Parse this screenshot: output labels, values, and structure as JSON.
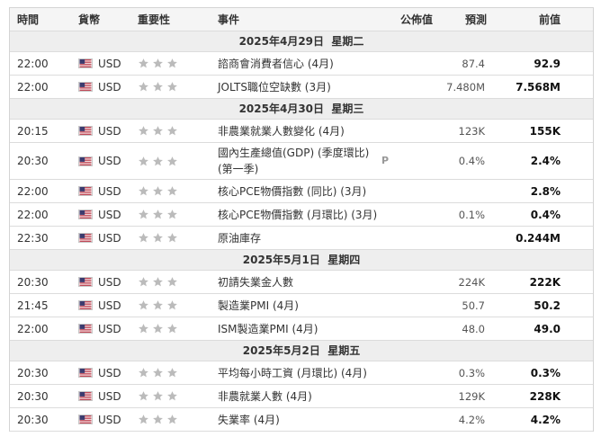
{
  "header": {
    "time": "時間",
    "currency": "貨幣",
    "importance": "重要性",
    "event": "事件",
    "actual": "公佈值",
    "forecast": "預測",
    "previous": "前值"
  },
  "colors": {
    "star": "#bbbbbb",
    "flag_red": "#b22234",
    "flag_blue": "#3c3b6e"
  },
  "icons": {
    "flag": "us-flag-icon",
    "star": "star-icon",
    "preliminary": "p-marker"
  },
  "days": [
    {
      "date": "2025年4月29日",
      "weekday": "星期二",
      "events": [
        {
          "time": "22:00",
          "currency": "USD",
          "event": "諮商會消費者信心 (4月)",
          "actual": "",
          "forecast": "87.4",
          "previous": "92.9"
        },
        {
          "time": "22:00",
          "currency": "USD",
          "event": "JOLTS職位空缺數 (3月)",
          "actual": "",
          "forecast": "7.480M",
          "previous": "7.568M"
        }
      ]
    },
    {
      "date": "2025年4月30日",
      "weekday": "星期三",
      "events": [
        {
          "time": "20:15",
          "currency": "USD",
          "event": "非農業就業人數變化 (4月)",
          "actual": "",
          "forecast": "123K",
          "previous": "155K"
        },
        {
          "time": "20:30",
          "currency": "USD",
          "event": "國內生產總值(GDP) (季度環比) (第一季)",
          "marker": "P",
          "actual": "",
          "forecast": "0.4%",
          "previous": "2.4%"
        },
        {
          "time": "22:00",
          "currency": "USD",
          "event": "核心PCE物價指數 (同比) (3月)",
          "actual": "",
          "forecast": "",
          "previous": "2.8%"
        },
        {
          "time": "22:00",
          "currency": "USD",
          "event": "核心PCE物價指數 (月環比) (3月)",
          "actual": "",
          "forecast": "0.1%",
          "previous": "0.4%"
        },
        {
          "time": "22:30",
          "currency": "USD",
          "event": "原油庫存",
          "actual": "",
          "forecast": "",
          "previous": "0.244M"
        }
      ]
    },
    {
      "date": "2025年5月1日",
      "weekday": "星期四",
      "events": [
        {
          "time": "20:30",
          "currency": "USD",
          "event": "初請失業金人數",
          "actual": "",
          "forecast": "224K",
          "previous": "222K"
        },
        {
          "time": "21:45",
          "currency": "USD",
          "event": "製造業PMI (4月)",
          "actual": "",
          "forecast": "50.7",
          "previous": "50.2"
        },
        {
          "time": "22:00",
          "currency": "USD",
          "event": "ISM製造業PMI (4月)",
          "actual": "",
          "forecast": "48.0",
          "previous": "49.0"
        }
      ]
    },
    {
      "date": "2025年5月2日",
      "weekday": "星期五",
      "events": [
        {
          "time": "20:30",
          "currency": "USD",
          "event": "平均每小時工資 (月環比) (4月)",
          "actual": "",
          "forecast": "0.3%",
          "previous": "0.3%"
        },
        {
          "time": "20:30",
          "currency": "USD",
          "event": "非農就業人數 (4月)",
          "actual": "",
          "forecast": "129K",
          "previous": "228K"
        },
        {
          "time": "20:30",
          "currency": "USD",
          "event": "失業率 (4月)",
          "actual": "",
          "forecast": "4.2%",
          "previous": "4.2%"
        }
      ]
    }
  ]
}
